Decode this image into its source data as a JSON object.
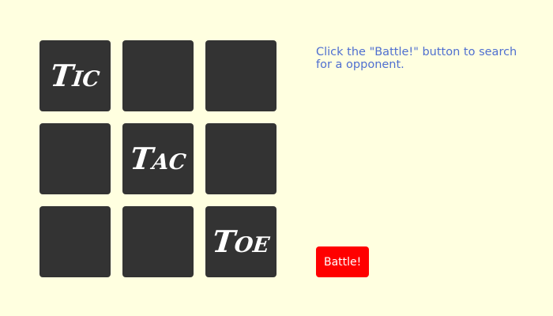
{
  "board": {
    "cells": [
      "Tic",
      "",
      "",
      "",
      "Tac",
      "",
      "",
      "",
      "Toe"
    ]
  },
  "message": "Click the \"Battle!\" button to search for a opponent.",
  "battle_button": {
    "label": "Battle!"
  },
  "colors": {
    "background": "#ffffe0",
    "cell": "#333333",
    "mark": "#ffffff",
    "message_text": "#4f6fd0",
    "battle_button": "#ff0000"
  }
}
